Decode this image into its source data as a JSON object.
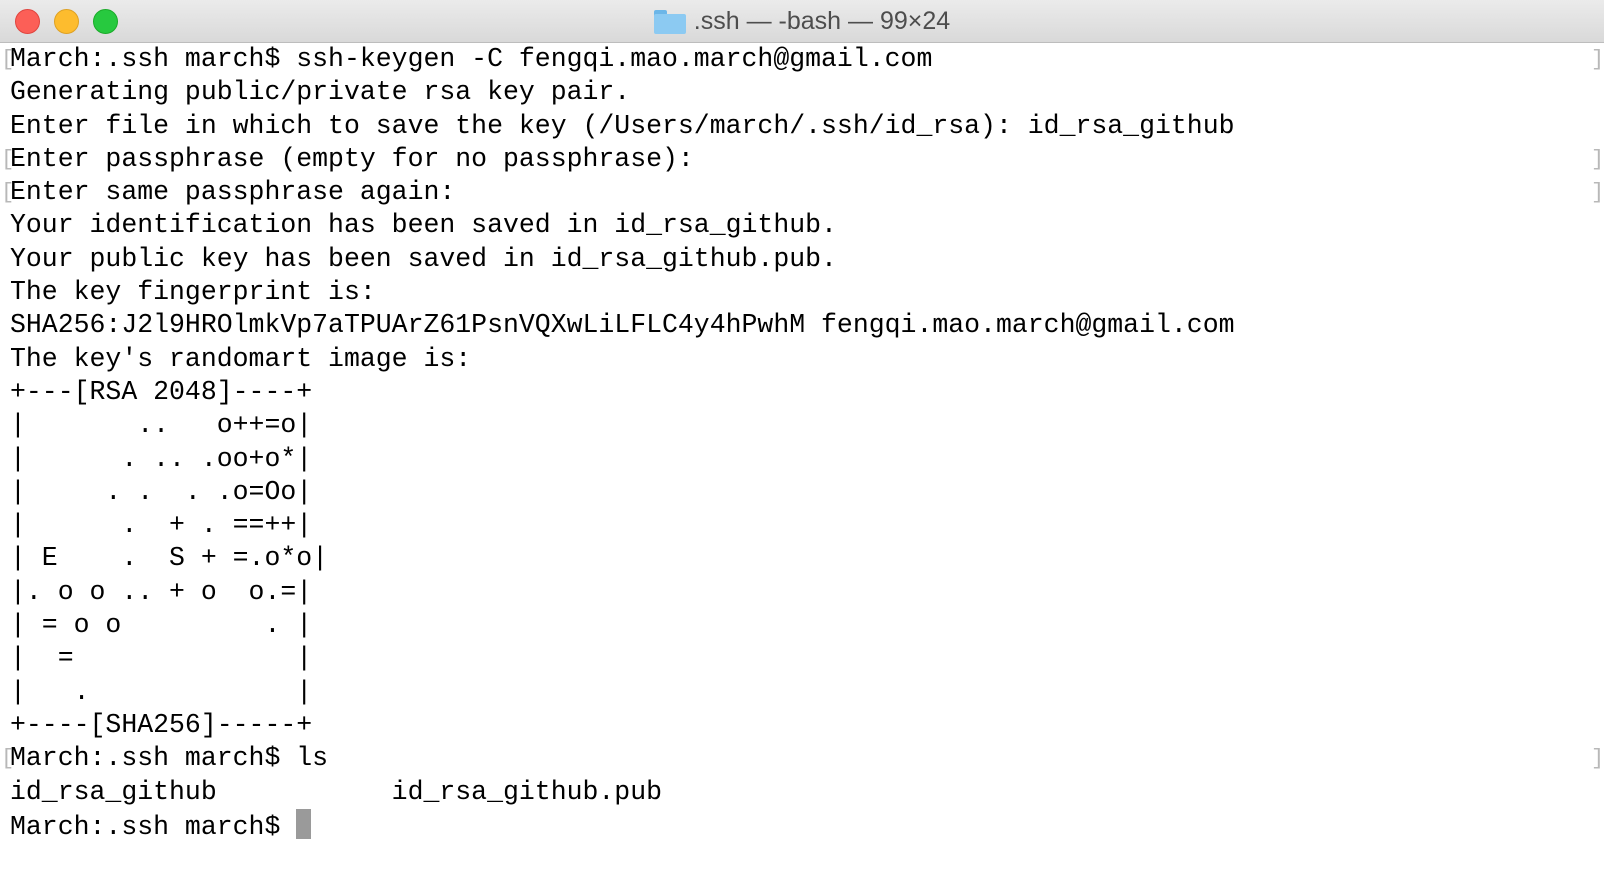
{
  "window": {
    "title": ".ssh — -bash — 99×24",
    "folder_icon": "folder-icon"
  },
  "terminal": {
    "lines": [
      "March:.ssh march$ ssh-keygen -C fengqi.mao.march@gmail.com",
      "Generating public/private rsa key pair.",
      "Enter file in which to save the key (/Users/march/.ssh/id_rsa): id_rsa_github",
      "Enter passphrase (empty for no passphrase):",
      "Enter same passphrase again:",
      "Your identification has been saved in id_rsa_github.",
      "Your public key has been saved in id_rsa_github.pub.",
      "The key fingerprint is:",
      "SHA256:J2l9HROlmkVp7aTPUArZ61PsnVQXwLiLFLC4y4hPwhM fengqi.mao.march@gmail.com",
      "The key's randomart image is:",
      "+---[RSA 2048]----+",
      "|       ..   o++=o|",
      "|      . .. .oo+o*|",
      "|     . .  . .o=Oo|",
      "|      .  + . ==++|",
      "| E    .  S + =.o*o|",
      "|. o o .. + o  o.=|",
      "| = o o         . |",
      "|  =              |",
      "|   .             |",
      "+----[SHA256]-----+",
      "March:.ssh march$ ls",
      "id_rsa_github           id_rsa_github.pub",
      "March:.ssh march$ "
    ],
    "bracketed_lines": [
      0,
      3,
      4,
      21
    ],
    "cursor_color": "#9a9a9a"
  }
}
